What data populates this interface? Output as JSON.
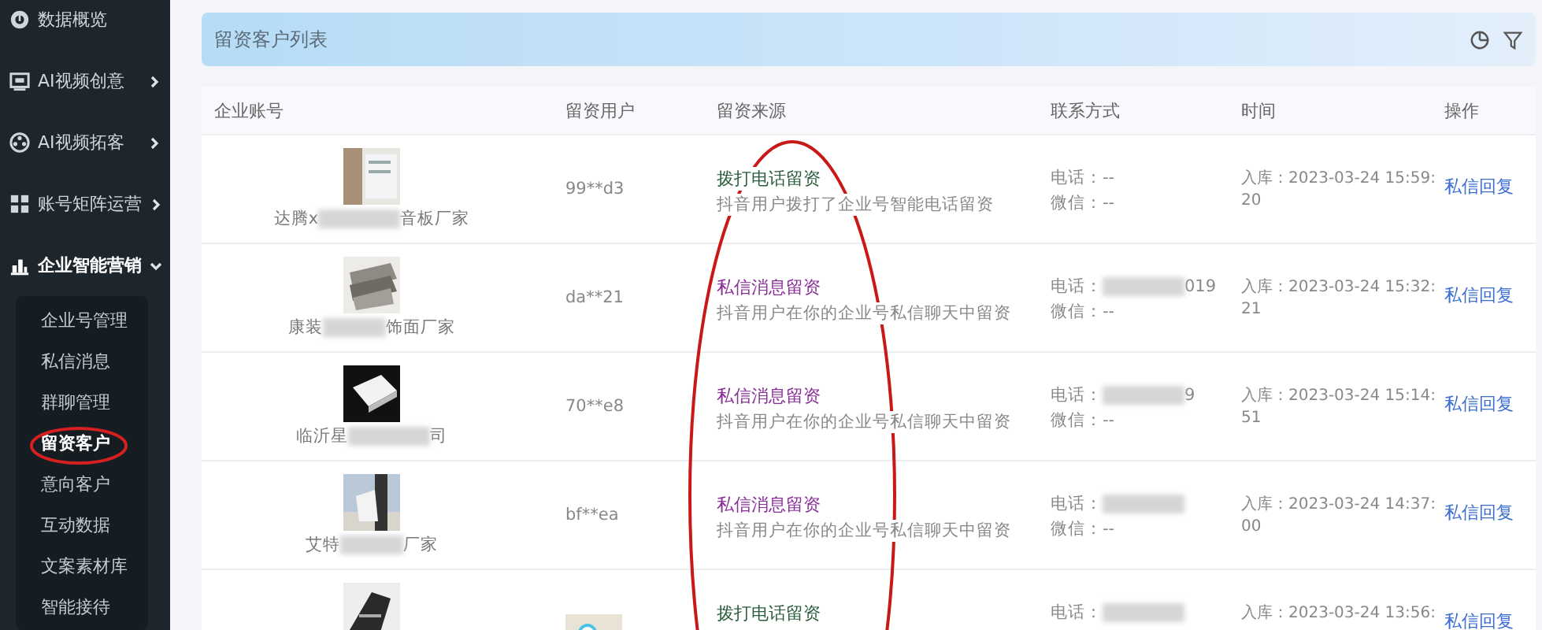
{
  "sidebar": {
    "items": [
      {
        "label": "数据概览",
        "has_children": false,
        "expanded": false
      },
      {
        "label": "AI视频创意",
        "has_children": true,
        "expanded": false
      },
      {
        "label": "AI视频拓客",
        "has_children": true,
        "expanded": false
      },
      {
        "label": "账号矩阵运营",
        "has_children": true,
        "expanded": false
      },
      {
        "label": "企业智能营销",
        "has_children": true,
        "expanded": true,
        "children": [
          {
            "label": "企业号管理",
            "selected": false
          },
          {
            "label": "私信消息",
            "selected": false
          },
          {
            "label": "群聊管理",
            "selected": false
          },
          {
            "label": "留资客户",
            "selected": true
          },
          {
            "label": "意向客户",
            "selected": false
          },
          {
            "label": "互动数据",
            "selected": false
          },
          {
            "label": "文案素材库",
            "selected": false
          },
          {
            "label": "智能接待",
            "selected": false
          }
        ]
      }
    ]
  },
  "panel": {
    "title": "留资客户列表"
  },
  "table": {
    "columns": [
      "企业账号",
      "留资用户",
      "留资来源",
      "联系方式",
      "时间",
      "操作"
    ],
    "rows": [
      {
        "account_start": "达腾ⅹ",
        "account_end": "音板厂家",
        "user": "99**d3",
        "kind": "call",
        "source": "拨打电话留资",
        "source_detail": "抖音用户拨打了企业号智能电话留资",
        "phone_label": "电话：--",
        "wechat": "微信：--",
        "time": "入库：2023-03-24 15:59:",
        "time_end": "20",
        "action": "私信回复"
      },
      {
        "account_start": "康装",
        "account_end": "饰面厂家",
        "user": "da**21",
        "kind": "message",
        "source": "私信消息留资",
        "source_detail": "抖音用户在你的企业号私信聊天中留资",
        "phone_label": "电话：",
        "phone_end": "019",
        "phone_masked": true,
        "wechat": "微信：--",
        "time": "入库：2023-03-24 15:32:",
        "time_end": "21",
        "action": "私信回复"
      },
      {
        "account_start": "临沂星",
        "account_end": "司",
        "user": "70**e8",
        "kind": "message",
        "source": "私信消息留资",
        "source_detail": "抖音用户在你的企业号私信聊天中留资",
        "phone_label": "电话：",
        "phone_end": "9",
        "phone_masked": true,
        "wechat": "微信：--",
        "time": "入库：2023-03-24 15:14:",
        "time_end": "51",
        "action": "私信回复"
      },
      {
        "account_start": "艾特",
        "account_end": "厂家",
        "user": "bf**ea",
        "kind": "message",
        "source": "私信消息留资",
        "source_detail": "抖音用户在你的企业号私信聊天中留资",
        "phone_label": "电话：",
        "phone_masked": true,
        "wechat": "微信：--",
        "time": "入库：2023-03-24 14:37:",
        "time_end": "00",
        "action": "私信回复"
      },
      {
        "user_avatar": true,
        "kind": "call",
        "source": "拨打电话留资",
        "phone_label": "电话：",
        "phone_masked": true,
        "time": "入库：2023-03-24 13:56:",
        "action": "私信回复"
      }
    ]
  }
}
